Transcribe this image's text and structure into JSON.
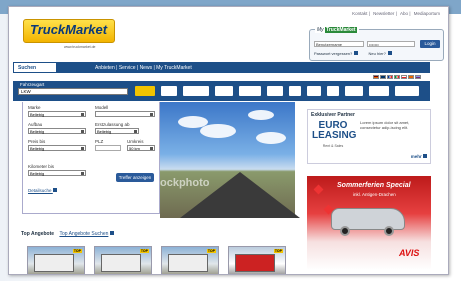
{
  "toplinks": [
    "Kontakt",
    "Newsletter",
    "Abo",
    "Mediaportum"
  ],
  "logo": {
    "text": "TruckMarket",
    "tagline": "www.truckmarket.de"
  },
  "login": {
    "title_prefix": "My",
    "title_brand": "TruckMarket",
    "username_label": "Benutzername",
    "password_value": "•••••••",
    "button": "Login",
    "forgot": "Passwort vergessen?",
    "register": "Neu hier?"
  },
  "nav": {
    "active_tab": "Suchen",
    "links": "Anbieten | Service | News | My TruckMarket"
  },
  "vehicle": {
    "label": "Fahrzeugart",
    "selected": "LKW"
  },
  "search": {
    "make_label": "Marke",
    "make_value": "Beliebig",
    "model_label": "Modell",
    "body_label": "Aufbau",
    "body_value": "Beliebig",
    "reg_label": "Erstzulassung ab",
    "reg_value": "Beliebig",
    "price_label": "Preis bis",
    "price_value": "Beliebig",
    "zip_label": "PLZ",
    "radius_label": "Umkreis",
    "radius_value": "50 km",
    "km_label": "Kilometer bis",
    "km_value": "Beliebig",
    "submit": "Treffer anzeigen",
    "detail_link": "Detailsuche"
  },
  "hero": {
    "watermark": "ockphoto"
  },
  "partner": {
    "title": "Exklusiver Partner",
    "logo_top": "EURO",
    "logo_bottom": "LEASING",
    "logo_sub": "Rent & Sales",
    "text": "Lorem ipsum dolor sit amet, consectetur adip-iscing elit.",
    "more": "mehr"
  },
  "ad": {
    "title": "Sommerferien Special",
    "subtitle": "inkl. Antigen-Drachen",
    "brand": "AVIS"
  },
  "offers": {
    "title": "Top Angebote",
    "link": "Top Angebote Suchen"
  },
  "thumb_badge": "TOP"
}
